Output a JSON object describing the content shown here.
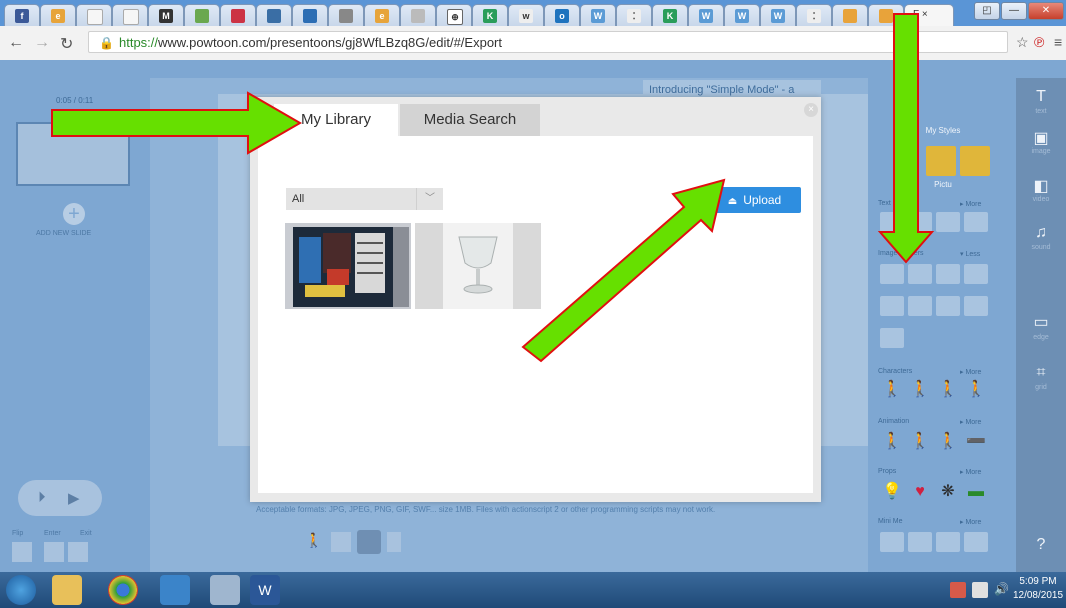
{
  "browser": {
    "url_scheme": "https://",
    "url_rest": "www.powtoon.com/presentoons/gj8WfLBzq8G/edit/#/Export",
    "tabs": [
      "f",
      "edu",
      "",
      "",
      "M",
      "",
      "",
      "",
      "",
      "",
      "edu",
      "DT",
      "",
      "K!",
      "W",
      "",
      "W",
      "",
      "K!",
      "W",
      "W",
      "W",
      "",
      "",
      "",
      "F ×"
    ]
  },
  "editor": {
    "slide_counter": "0:05 / 0:11",
    "add_slide_label": "ADD NEW SLIDE",
    "simple_mode_text": "Introducing \"Simple Mode\" - a quick and ... way to create ... our ready ... layouts.",
    "right_panel": {
      "header": "My Styles",
      "subheader": "Pictu",
      "sections": [
        {
          "label": "Text Effects",
          "action": "▸ More"
        },
        {
          "label": "Image Holders",
          "action": "▾ Less"
        },
        {
          "label": "Characters",
          "action": "▸ More"
        },
        {
          "label": "Animation",
          "action": "▸ More"
        },
        {
          "label": "Props",
          "action": "▸ More"
        },
        {
          "label": "Mini Me",
          "action": "▸ More"
        }
      ]
    },
    "toolbar": [
      {
        "icon": "T",
        "label": "text"
      },
      {
        "icon": "▣",
        "label": "image"
      },
      {
        "icon": "◧",
        "label": "video"
      },
      {
        "icon": "♫",
        "label": "sound"
      },
      {
        "icon": "▭",
        "label": "edge"
      },
      {
        "icon": "⌗",
        "label": "grid"
      },
      {
        "icon": "?",
        "label": ""
      }
    ],
    "footer_text": "Acceptable formats: JPG, JPEG, PNG, GIF, SWF... size 1MB. Files with actionscript 2 or other programming scripts may not work.",
    "flip_label": "Flip",
    "enter_label": "Enter",
    "exit_label": "Exit"
  },
  "modal": {
    "tabs": {
      "library": "My Library",
      "media": "Media Search"
    },
    "filter_value": "All",
    "upload_label": "Upload"
  },
  "taskbar": {
    "time": "5:09 PM",
    "date": "12/08/2015"
  }
}
